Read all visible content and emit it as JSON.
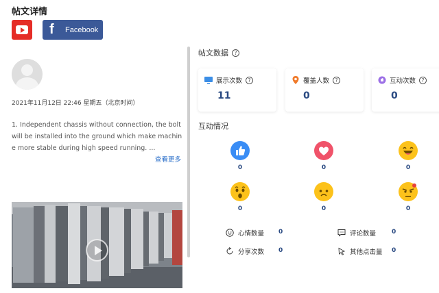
{
  "page": {
    "title": "帖文详情"
  },
  "share": {
    "youtube_icon": "youtube-icon",
    "facebook_label": "Facebook"
  },
  "post": {
    "date": "2021年11月12日 22:46 星期五（北京时间）",
    "text": "1. Independent chassis without connection, the bolt will be installed into the ground which make machine more stable during high speed running. ...",
    "see_more": "查看更多"
  },
  "stats": {
    "title": "帖文数据",
    "cards": [
      {
        "label": "展示次数",
        "value": "11",
        "icon": "monitor-icon"
      },
      {
        "label": "覆盖人数",
        "value": "0",
        "icon": "location-pin-icon"
      },
      {
        "label": "互动次数",
        "value": "0",
        "icon": "interaction-icon"
      }
    ]
  },
  "interaction": {
    "title": "互动情况",
    "reactions": [
      {
        "icon": "like-icon",
        "value": "0"
      },
      {
        "icon": "love-icon",
        "value": "0"
      },
      {
        "icon": "haha-icon",
        "value": "0"
      },
      {
        "icon": "wow-icon",
        "value": "0"
      },
      {
        "icon": "sad-icon",
        "value": "0"
      },
      {
        "icon": "angry-icon",
        "value": "0"
      }
    ],
    "metrics": [
      {
        "label": "心情数量",
        "value": "0",
        "icon": "smile-outline-icon"
      },
      {
        "label": "评论数量",
        "value": "0",
        "icon": "comment-icon"
      },
      {
        "label": "分享次数",
        "value": "0",
        "icon": "share-icon"
      },
      {
        "label": "其他点击量",
        "value": "0",
        "icon": "cursor-click-icon"
      }
    ]
  },
  "colors": {
    "accent": "#2a4a82",
    "link": "#2b6fc9",
    "youtube": "#e52d27",
    "facebook": "#3b5998"
  }
}
